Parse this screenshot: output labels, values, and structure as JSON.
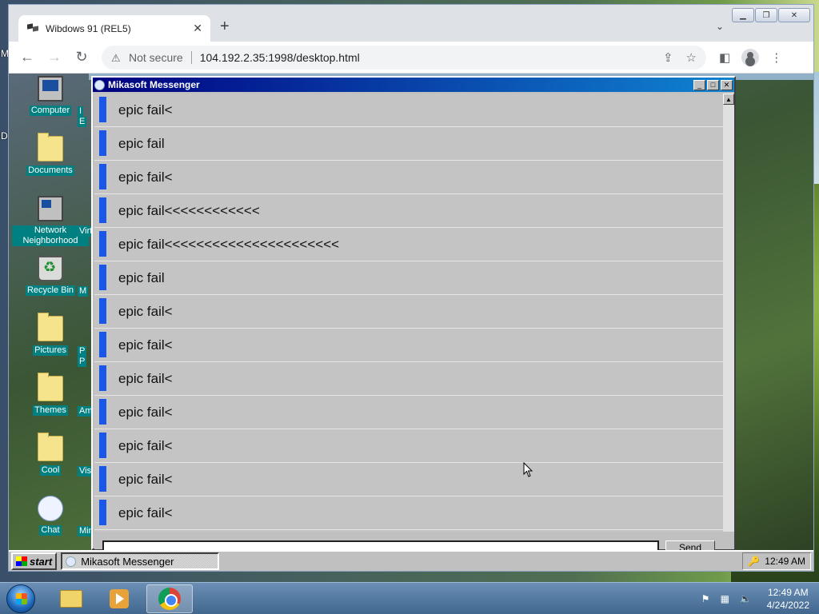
{
  "outer_desktop": {
    "left_labels": [
      "M",
      "D"
    ]
  },
  "browser": {
    "tab_title": "Wibdows 91 (REL5)",
    "not_secure_label": "Not secure",
    "url": "104.192.2.35:1998/desktop.html"
  },
  "w91_desktop": {
    "icons": [
      {
        "label": "Computer",
        "glyph": "computer-icon"
      },
      {
        "label": "Documents",
        "glyph": "folder-icon"
      },
      {
        "label": "Network Neighborhood",
        "glyph": "network-icon"
      },
      {
        "label": "Recycle Bin",
        "glyph": "recycle-bin-icon"
      },
      {
        "label": "Pictures",
        "glyph": "folder-icon"
      },
      {
        "label": "Themes",
        "glyph": "folder-icon"
      },
      {
        "label": "Cool",
        "glyph": "folder-icon"
      },
      {
        "label": "Chat",
        "glyph": "chat-bubble-icon"
      }
    ],
    "partial_icons": [
      "I",
      "E",
      "Virtu",
      "M",
      "P",
      "P",
      "Ame",
      "Vis",
      "Min"
    ]
  },
  "messenger": {
    "title": "Mikasoft Messenger",
    "messages": [
      "epic fail<",
      "epic fail",
      "epic fail<",
      "epic fail<<<<<<<<<<<<",
      "epic fail<<<<<<<<<<<<<<<<<<<<<<",
      "epic fail",
      "epic fail<",
      "epic fail<",
      "epic fail<",
      "epic fail<",
      "epic fail<",
      "epic fail<",
      "epic fail<"
    ],
    "send_label": "Send",
    "accent_color": "#1a56e8"
  },
  "w91_taskbar": {
    "start_label": "start",
    "task_label": "Mikasoft Messenger",
    "clock": "12:49 AM"
  },
  "w7_taskbar": {
    "time": "12:49 AM",
    "date": "4/24/2022"
  }
}
